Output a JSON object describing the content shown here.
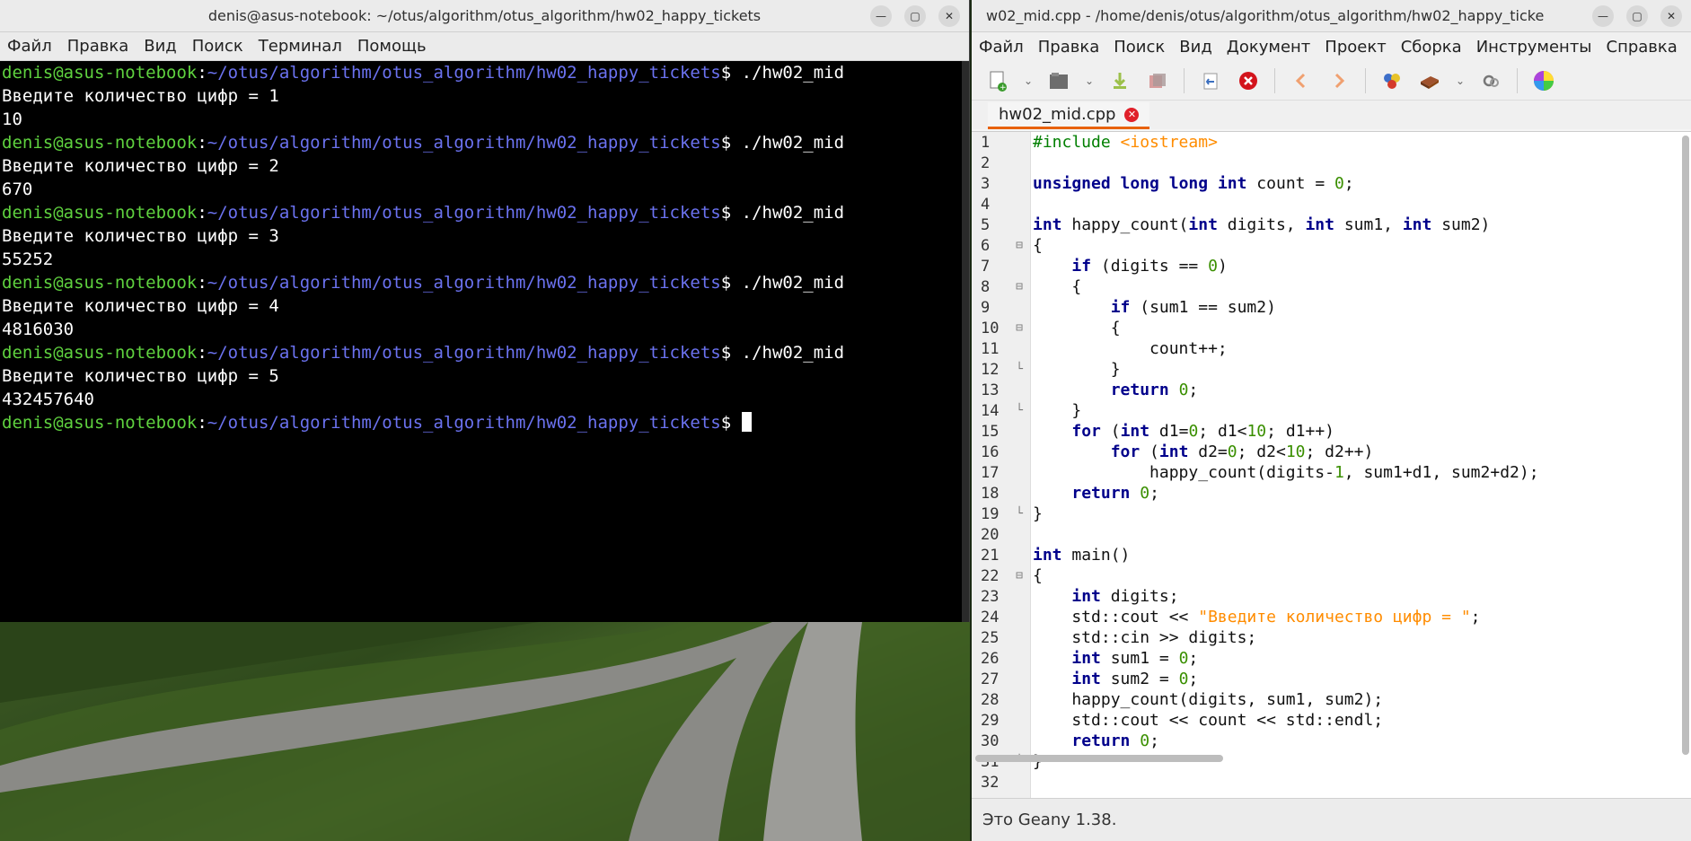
{
  "terminal": {
    "title": "denis@asus-notebook: ~/otus/algorithm/otus_algorithm/hw02_happy_tickets",
    "menu": [
      "Файл",
      "Правка",
      "Вид",
      "Поиск",
      "Терминал",
      "Помощь"
    ],
    "prompt_user": "denis@asus-notebook",
    "prompt_path": "~/otus/algorithm/otus_algorithm/hw02_happy_tickets",
    "command": "./hw02_mid",
    "sessions": [
      {
        "question": "Введите количество цифр = 1",
        "result": "10"
      },
      {
        "question": "Введите количество цифр = 2",
        "result": "670"
      },
      {
        "question": "Введите количество цифр = 3",
        "result": "55252"
      },
      {
        "question": "Введите количество цифр = 4",
        "result": "4816030"
      },
      {
        "question": "Введите количество цифр = 5",
        "result": "432457640"
      }
    ]
  },
  "geany": {
    "title": "w02_mid.cpp - /home/denis/otus/algorithm/otus_algorithm/hw02_happy_ticke",
    "menu": [
      "Файл",
      "Правка",
      "Поиск",
      "Вид",
      "Документ",
      "Проект",
      "Сборка",
      "Инструменты",
      "Справка"
    ],
    "tab_label": "hw02_mid.cpp",
    "status": "Это Geany 1.38.",
    "code": [
      "#include <iostream>",
      "",
      "unsigned long long int count = 0;",
      "",
      "int happy_count(int digits, int sum1, int sum2)",
      "{",
      "    if (digits == 0)",
      "    {",
      "        if (sum1 == sum2)",
      "        {",
      "            count++;",
      "        }",
      "        return 0;",
      "    }",
      "    for (int d1=0; d1<10; d1++)",
      "        for (int d2=0; d2<10; d2++)",
      "            happy_count(digits-1, sum1+d1, sum2+d2);",
      "    return 0;",
      "}",
      "",
      "int main()",
      "{",
      "    int digits;",
      "    std::cout << \"Введите количество цифр = \";",
      "    std::cin >> digits;",
      "    int sum1 = 0;",
      "    int sum2 = 0;",
      "    happy_count(digits, sum1, sum2);",
      "    std::cout << count << std::endl;",
      "    return 0;",
      "}",
      ""
    ],
    "fold_markers": {
      "6": "⊟",
      "8": "⊟",
      "10": "⊟",
      "12": "└",
      "14": "└",
      "19": "└",
      "22": "⊟",
      "31": "└"
    }
  },
  "icons": {
    "minimize": "minimize-icon",
    "maximize": "maximize-icon",
    "close": "close-icon"
  },
  "colors": {
    "prompt_user": "#5fd23f",
    "prompt_path": "#6b72f0",
    "keyword": "#00008b",
    "number": "#3a8f00",
    "string": "#ff8c00",
    "tab_accent": "#e8620c"
  }
}
